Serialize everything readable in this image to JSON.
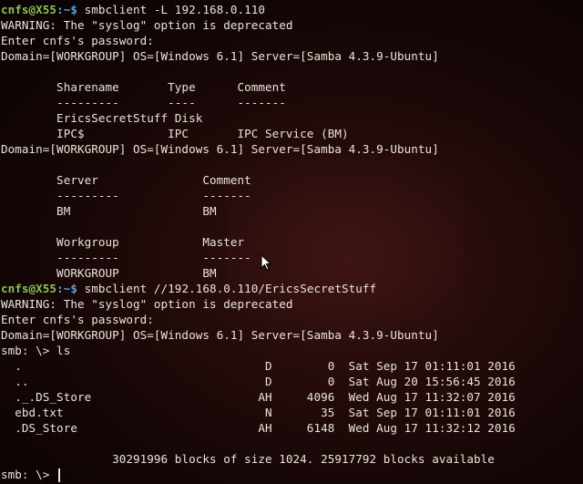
{
  "terminal": {
    "prompt_user": "cnfs@X55",
    "prompt_sep": ":~$ ",
    "lines": [
      {
        "type": "cmd",
        "text": "smbclient -L 192.168.0.110"
      },
      {
        "type": "out",
        "text": "WARNING: The \"syslog\" option is deprecated"
      },
      {
        "type": "out",
        "text": "Enter cnfs's password:"
      },
      {
        "type": "out",
        "text": "Domain=[WORKGROUP] OS=[Windows 6.1] Server=[Samba 4.3.9-Ubuntu]"
      },
      {
        "type": "out",
        "text": ""
      },
      {
        "type": "out",
        "text": "        Sharename       Type      Comment"
      },
      {
        "type": "out",
        "text": "        ---------       ----      -------"
      },
      {
        "type": "out",
        "text": "        EricsSecretStuff Disk"
      },
      {
        "type": "out",
        "text": "        IPC$            IPC       IPC Service (BM)"
      },
      {
        "type": "out",
        "text": "Domain=[WORKGROUP] OS=[Windows 6.1] Server=[Samba 4.3.9-Ubuntu]"
      },
      {
        "type": "out",
        "text": ""
      },
      {
        "type": "out",
        "text": "        Server               Comment"
      },
      {
        "type": "out",
        "text": "        ---------            -------"
      },
      {
        "type": "out",
        "text": "        BM                   BM"
      },
      {
        "type": "out",
        "text": ""
      },
      {
        "type": "out",
        "text": "        Workgroup            Master"
      },
      {
        "type": "out",
        "text": "        ---------            -------"
      },
      {
        "type": "out",
        "text": "        WORKGROUP            BM"
      },
      {
        "type": "cmd",
        "text": "smbclient //192.168.0.110/EricsSecretStuff"
      },
      {
        "type": "out",
        "text": "WARNING: The \"syslog\" option is deprecated"
      },
      {
        "type": "out",
        "text": "Enter cnfs's password:"
      },
      {
        "type": "out",
        "text": "Domain=[WORKGROUP] OS=[Windows 6.1] Server=[Samba 4.3.9-Ubuntu]"
      },
      {
        "type": "out",
        "text": "smb: \\> ls"
      },
      {
        "type": "out",
        "text": "  .                                   D        0  Sat Sep 17 01:11:01 2016"
      },
      {
        "type": "out",
        "text": "  ..                                  D        0  Sat Aug 20 15:56:45 2016"
      },
      {
        "type": "out",
        "text": "  ._.DS_Store                        AH     4096  Wed Aug 17 11:32:07 2016"
      },
      {
        "type": "out",
        "text": "  ebd.txt                             N       35  Sat Sep 17 01:11:01 2016"
      },
      {
        "type": "out",
        "text": "  .DS_Store                          AH     6148  Wed Aug 17 11:32:12 2016"
      },
      {
        "type": "out",
        "text": ""
      },
      {
        "type": "out",
        "text": "                30291996 blocks of size 1024. 25917792 blocks available"
      },
      {
        "type": "prompt",
        "text": "smb: \\> "
      }
    ]
  },
  "colors": {
    "user": "#8bc34a",
    "path": "#5aa3e0",
    "text": "#e8e6d8",
    "background": "#1a0707"
  },
  "icons": {
    "mouse": "mouse-pointer-icon"
  }
}
